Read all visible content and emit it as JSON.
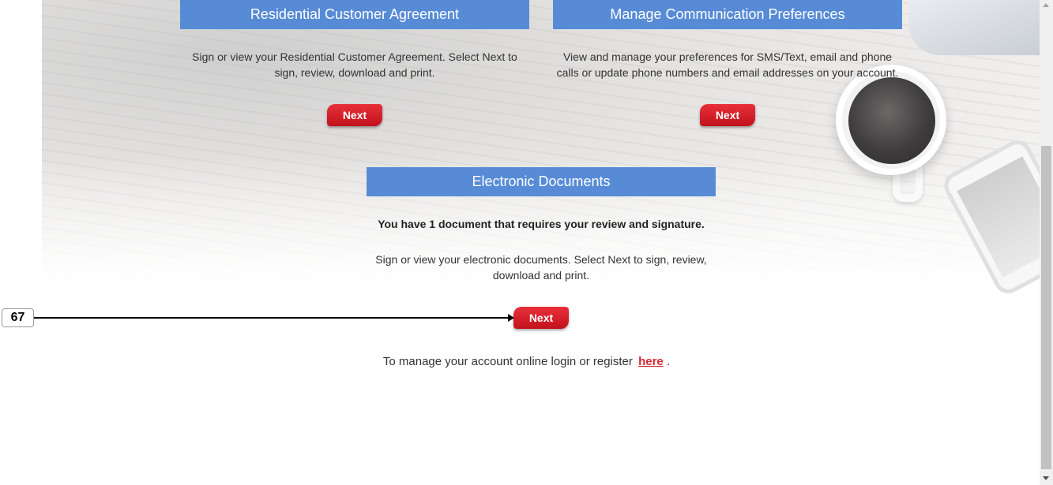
{
  "sections": {
    "residential": {
      "title": "Residential Customer Agreement",
      "description": "Sign or view your Residential Customer Agreement. Select Next to sign, review, download and print.",
      "next_label": "Next"
    },
    "communication": {
      "title": "Manage Communication Preferences",
      "description": "View and manage your preferences for SMS/Text, email and phone calls or update phone numbers and email addresses on your account.",
      "next_label": "Next"
    },
    "documents": {
      "title": "Electronic Documents",
      "notice": "You have 1 document that requires your review and signature.",
      "description": "Sign or view your electronic documents. Select Next to sign, review, download and print.",
      "next_label": "Next"
    }
  },
  "footer": {
    "text": "To manage your account online login or register",
    "link_label": "here",
    "suffix": "."
  },
  "callout": {
    "label": "67"
  },
  "colors": {
    "header_blue": "#578bd6",
    "button_red": "#d0181f",
    "link_red": "#d62631"
  }
}
